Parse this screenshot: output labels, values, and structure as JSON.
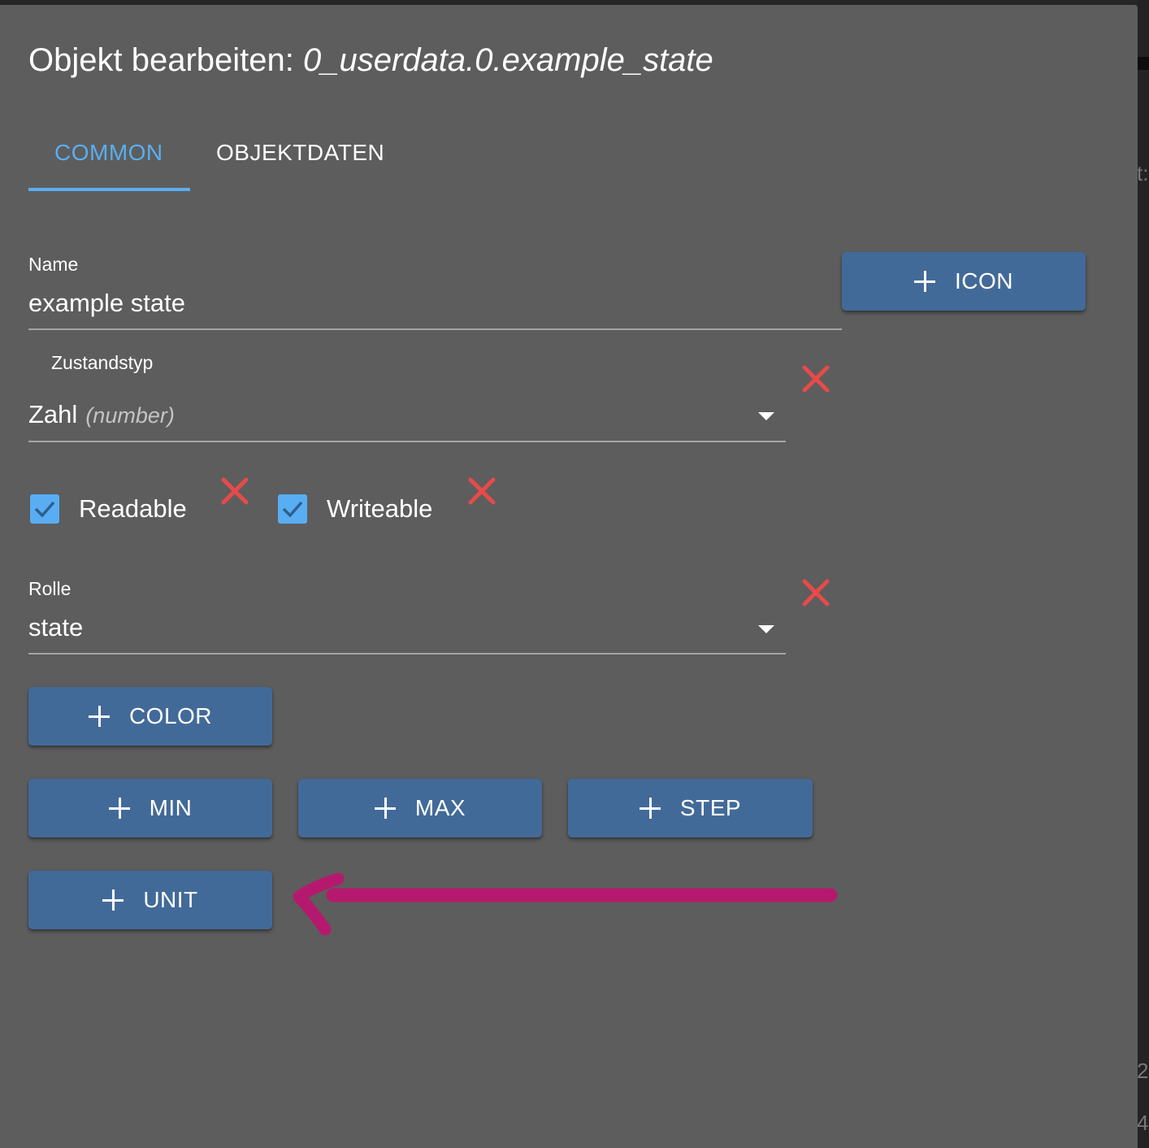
{
  "dialog": {
    "title_prefix": "Objekt bearbeiten: ",
    "object_id": "0_userdata.0.example_state"
  },
  "tabs": [
    {
      "label": "COMMON",
      "active": true
    },
    {
      "label": "OBJEKTDATEN",
      "active": false
    }
  ],
  "name_field": {
    "label": "Name",
    "value": "example state"
  },
  "type_field": {
    "label": "Zustandstyp",
    "value": "Zahl",
    "hint": "(number)"
  },
  "checkboxes": {
    "readable": {
      "label": "Readable",
      "checked": true
    },
    "writeable": {
      "label": "Writeable",
      "checked": true
    }
  },
  "role_field": {
    "label": "Rolle",
    "value": "state"
  },
  "buttons": {
    "icon": "ICON",
    "color": "COLOR",
    "min": "MIN",
    "max": "MAX",
    "step": "STEP",
    "unit": "UNIT"
  },
  "background_fragments": {
    "top": "t:",
    "mid": "2",
    "bottom": "4"
  },
  "colors": {
    "dialog_bg": "#5d5d5d",
    "accent": "#5aaef0",
    "button_bg": "#426a98",
    "delete_x": "#e84a4a",
    "annotation_arrow": "#b5196e"
  },
  "icons": {
    "add": "plus-icon",
    "delete": "close-icon",
    "dropdown": "caret-down-icon",
    "check": "check-icon"
  }
}
